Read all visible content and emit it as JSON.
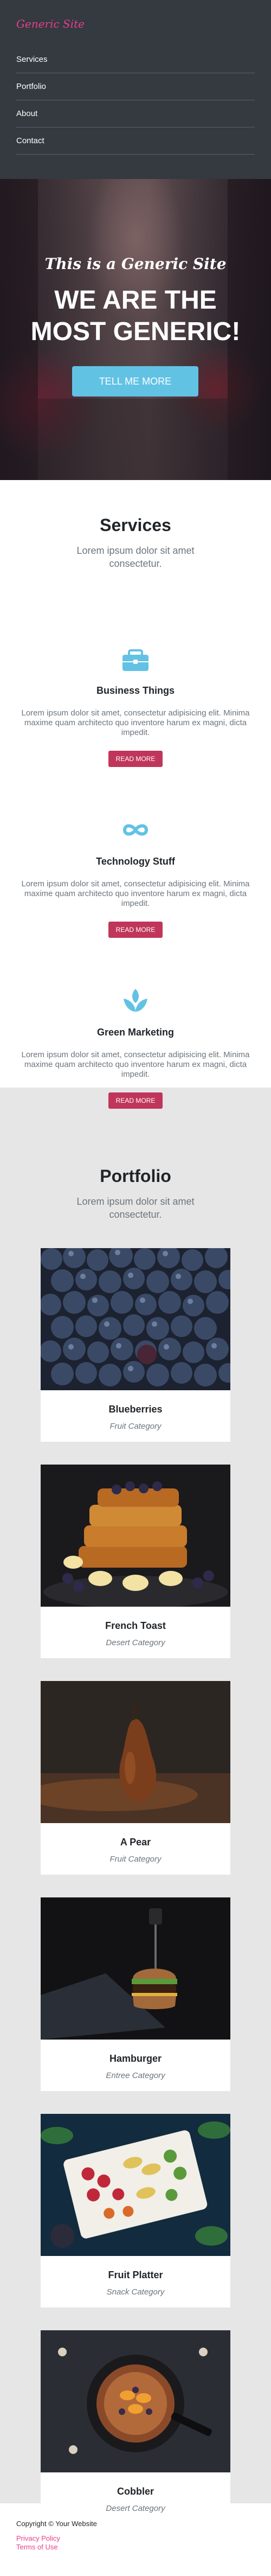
{
  "nav": {
    "brand": "Generic Site",
    "items": [
      {
        "label": "Services"
      },
      {
        "label": "Portfolio"
      },
      {
        "label": "About"
      },
      {
        "label": "Contact"
      }
    ]
  },
  "hero": {
    "subheading": "This is a Generic Site",
    "heading_line1": "WE ARE THE",
    "heading_line2": "MOST GENERIC!",
    "button_label": "TELL ME MORE"
  },
  "services": {
    "title": "Services",
    "subtitle": "Lorem ipsum dolor sit amet consectetur.",
    "items": [
      {
        "icon": "briefcase-icon",
        "name": "Business Things",
        "text": "Lorem ipsum dolor sit amet, consectetur adipisicing elit. Minima maxime quam architecto quo inventore harum ex magni, dicta impedit.",
        "button": "READ MORE"
      },
      {
        "icon": "infinity-icon",
        "name": "Technology Stuff",
        "text": "Lorem ipsum dolor sit amet, consectetur adipisicing elit. Minima maxime quam architecto quo inventore harum ex magni, dicta impedit.",
        "button": "READ MORE"
      },
      {
        "icon": "leaf-icon",
        "name": "Green Marketing",
        "text": "Lorem ipsum dolor sit amet, consectetur adipisicing elit. Minima maxime quam architecto quo inventore harum ex magni, dicta impedit.",
        "button": "READ MORE"
      }
    ]
  },
  "portfolio": {
    "title": "Portfolio",
    "subtitle": "Lorem ipsum dolor sit amet consectetur.",
    "items": [
      {
        "title": "Blueberries",
        "category": "Fruit Category"
      },
      {
        "title": "French Toast",
        "category": "Desert Category"
      },
      {
        "title": "A Pear",
        "category": "Fruit Category"
      },
      {
        "title": "Hamburger",
        "category": "Entree Category"
      },
      {
        "title": "Fruit Platter",
        "category": "Snack Category"
      },
      {
        "title": "Cobbler",
        "category": "Desert Category"
      }
    ]
  },
  "footer": {
    "copyright": "Copyright © Your Website",
    "links": [
      {
        "label": "Privacy Policy"
      },
      {
        "label": "Terms of Use"
      }
    ]
  },
  "colors": {
    "brand_pink": "#e83e8c",
    "accent_blue": "#62c2e4",
    "button_red": "#c0365a",
    "nav_dark": "#343a40"
  }
}
